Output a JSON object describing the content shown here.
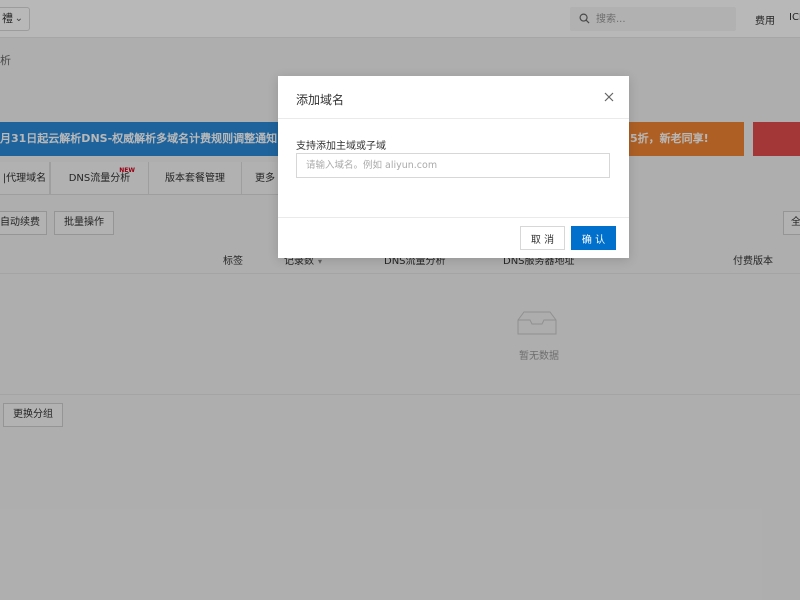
{
  "topbar": {
    "product_select_label": "禮",
    "search_placeholder": "搜索...",
    "link_fee": "费用",
    "link_icp": "ICI"
  },
  "breadcrumb": "析",
  "banners": {
    "blue_text": "月31日起云解析DNS-权威解析多域名计费规则调整通知",
    "orange_text": "5折，新老同享!"
  },
  "tabs": [
    {
      "label": "|代理域名"
    },
    {
      "label": "DNS流量分析",
      "badge": "NEW"
    },
    {
      "label": "版本套餐管理"
    },
    {
      "label": "更多"
    }
  ],
  "toolbar": {
    "auto_renew_label": "自动续费",
    "batch_label": "批量操作",
    "right_button_label": "全"
  },
  "table": {
    "headers": [
      "标签",
      "记录数",
      "DNS流量分析",
      "DNS服务器地址",
      "付费版本"
    ]
  },
  "empty_text": "暂无数据",
  "change_group_label": "更换分组",
  "modal": {
    "title": "添加域名",
    "field_label": "支持添加主域或子域",
    "input_placeholder": "请输入域名。例如 aliyun.com",
    "input_value": "",
    "cancel_label": "取 消",
    "ok_label": "确 认"
  },
  "colors": {
    "primary": "#0070cc",
    "banner_blue": "#2b89d8",
    "banner_orange": "#f18632",
    "banner_red": "#e24c4c"
  }
}
